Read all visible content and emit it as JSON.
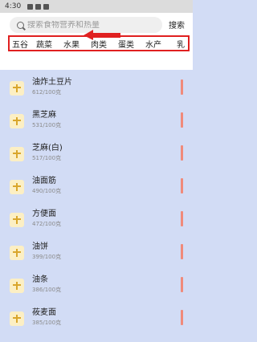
{
  "status": {
    "time": "4:30"
  },
  "search": {
    "placeholder": "搜索食物营养和热量",
    "button": "搜索"
  },
  "categories": [
    "五谷",
    "蔬菜",
    "水果",
    "肉类",
    "蛋类",
    "水产",
    "乳"
  ],
  "foods": [
    {
      "name": "油炸土豆片",
      "kcal": "612/100克"
    },
    {
      "name": "黑芝麻",
      "kcal": "531/100克"
    },
    {
      "name": "芝麻(白)",
      "kcal": "517/100克"
    },
    {
      "name": "油面筋",
      "kcal": "490/100克"
    },
    {
      "name": "方便面",
      "kcal": "472/100克"
    },
    {
      "name": "油饼",
      "kcal": "399/100克"
    },
    {
      "name": "油条",
      "kcal": "386/100克"
    },
    {
      "name": "莜麦面",
      "kcal": "385/100克"
    }
  ]
}
